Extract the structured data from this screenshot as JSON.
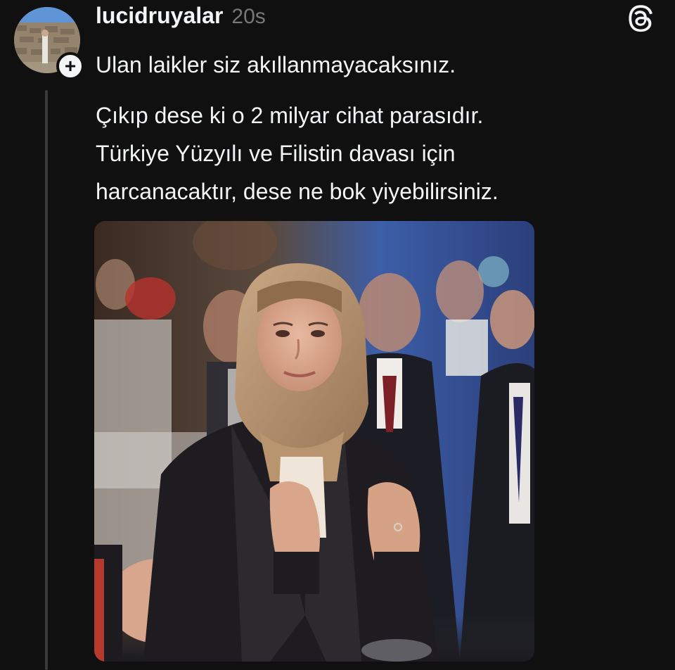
{
  "post": {
    "username": "lucidruyalar",
    "timestamp": "20s",
    "follow_symbol": "+",
    "text_lines": [
      "Ulan laikler siz akıllanmayacaksınız.",
      "Çıkıp dese ki o 2 milyar cihat parasıdır.",
      "Türkiye Yüzyılı ve Filistin davası için",
      "harcanacaktır, dese ne bok yiyebilirsiniz."
    ]
  },
  "icons": {
    "app_logo": "threads-icon",
    "follow": "plus-icon"
  },
  "colors": {
    "background": "#101010",
    "text": "#f3f5f7",
    "secondary_text": "#777777",
    "thread_line": "#3a3a3a"
  }
}
